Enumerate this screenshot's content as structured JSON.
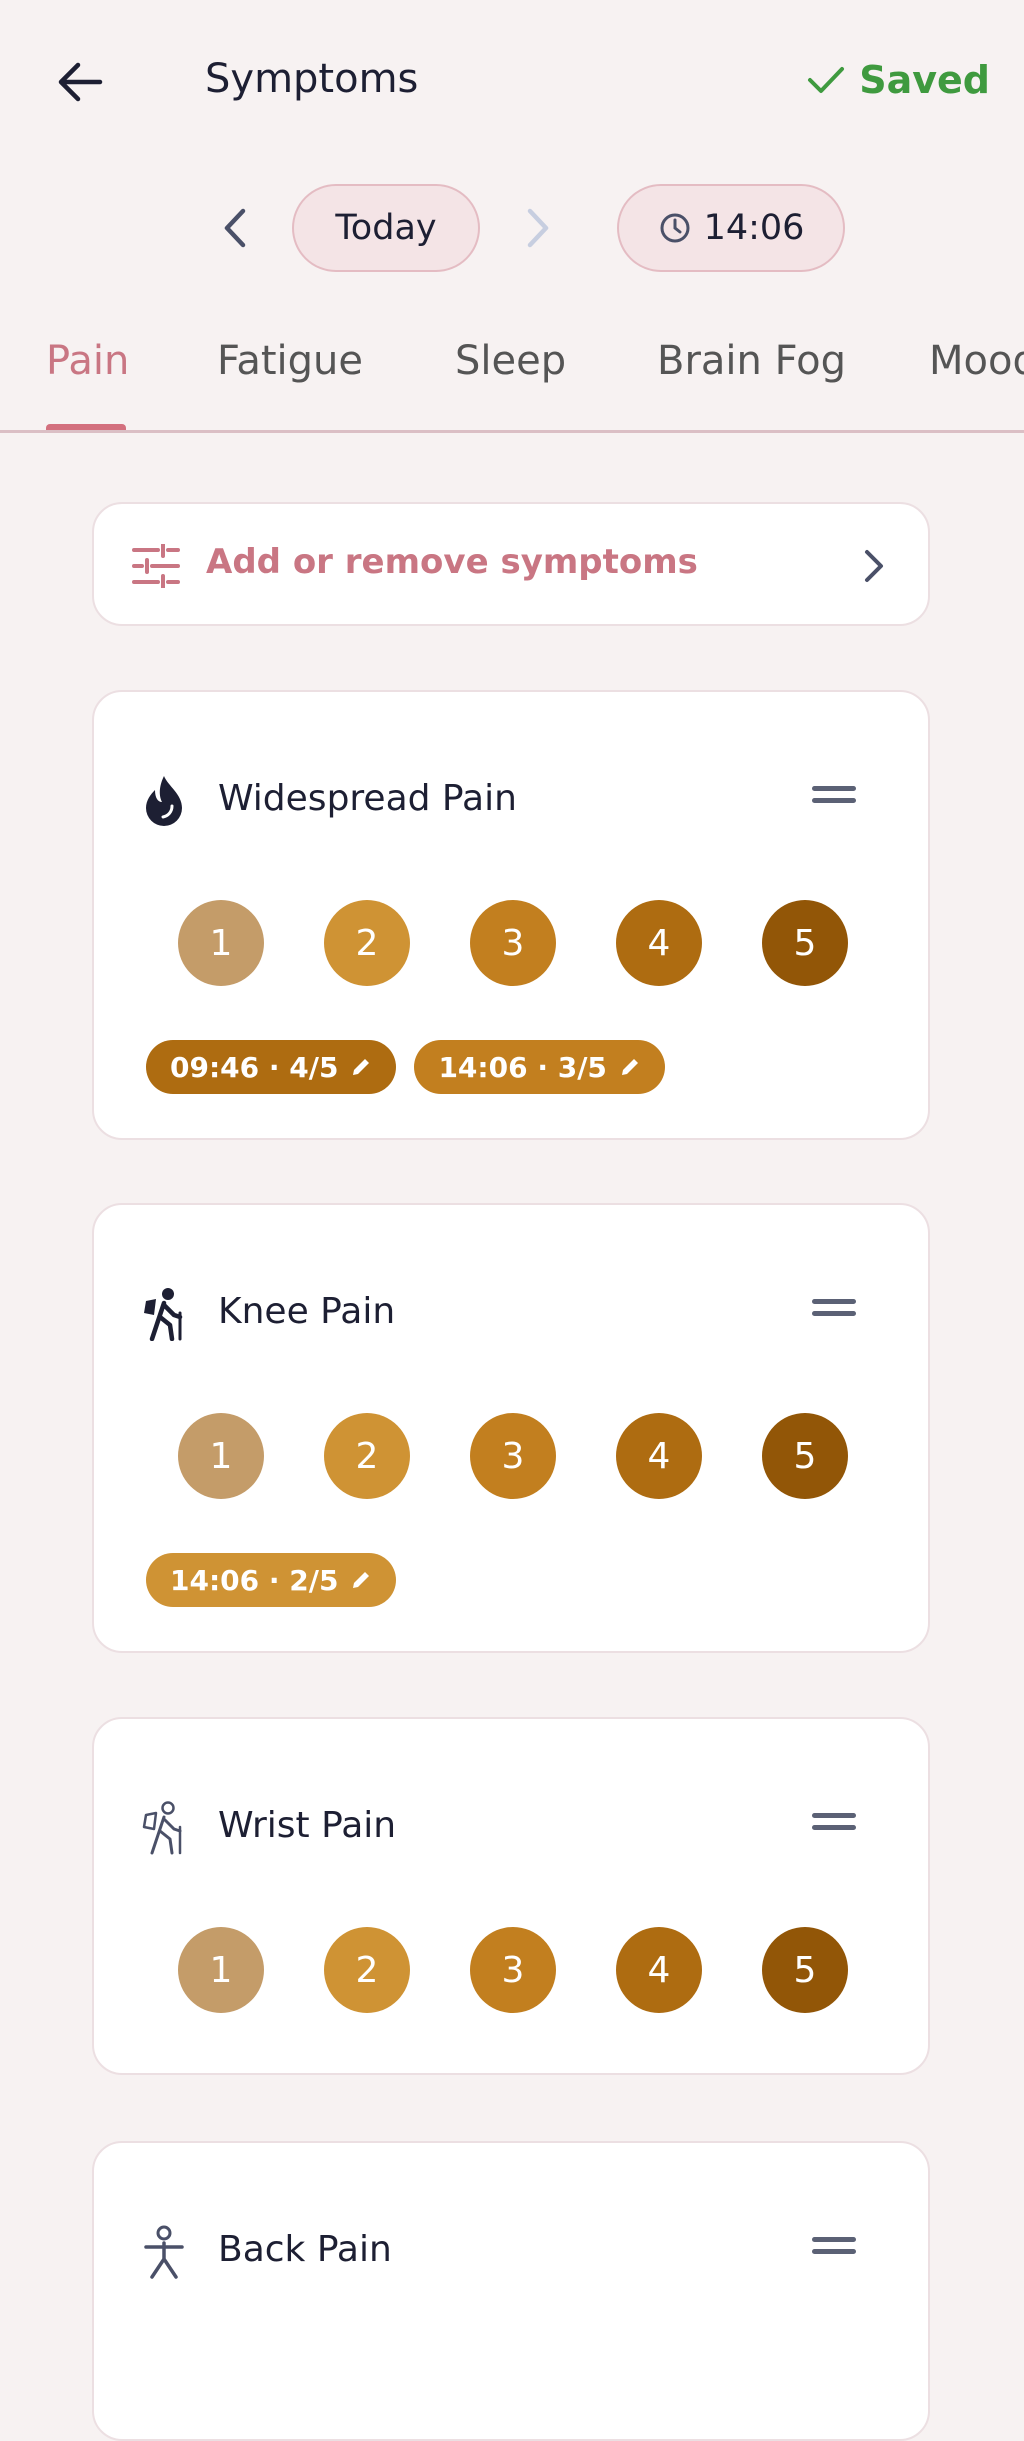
{
  "header": {
    "title": "Symptoms",
    "saved_label": "Saved"
  },
  "date": {
    "day_label": "Today",
    "time_label": "14:06"
  },
  "tabs": [
    {
      "label": "Pain"
    },
    {
      "label": "Fatigue"
    },
    {
      "label": "Sleep"
    },
    {
      "label": "Brain Fog"
    },
    {
      "label": "Mood"
    }
  ],
  "add_symptoms": {
    "label": "Add or remove symptoms"
  },
  "colors": {
    "accent": "#c97683",
    "saved": "#3f9a3f",
    "level_1": "#c49c69",
    "level_2": "#cf9334",
    "level_3": "#c27f1f",
    "level_4": "#ae6c11",
    "level_5": "#925607"
  },
  "scale": [
    "1",
    "2",
    "3",
    "4",
    "5"
  ],
  "symptoms": [
    {
      "name": "Widespread Pain",
      "icon": "flame-icon",
      "entries": [
        {
          "label": "09:46 · 4/5",
          "level": 4
        },
        {
          "label": "14:06 · 3/5",
          "level": 3
        }
      ]
    },
    {
      "name": "Knee Pain",
      "icon": "hiker-icon",
      "entries": [
        {
          "label": "14:06 · 2/5",
          "level": 2
        }
      ]
    },
    {
      "name": "Wrist Pain",
      "icon": "hiker-outline-icon",
      "entries": []
    },
    {
      "name": "Back Pain",
      "icon": "person-icon",
      "entries": []
    }
  ]
}
